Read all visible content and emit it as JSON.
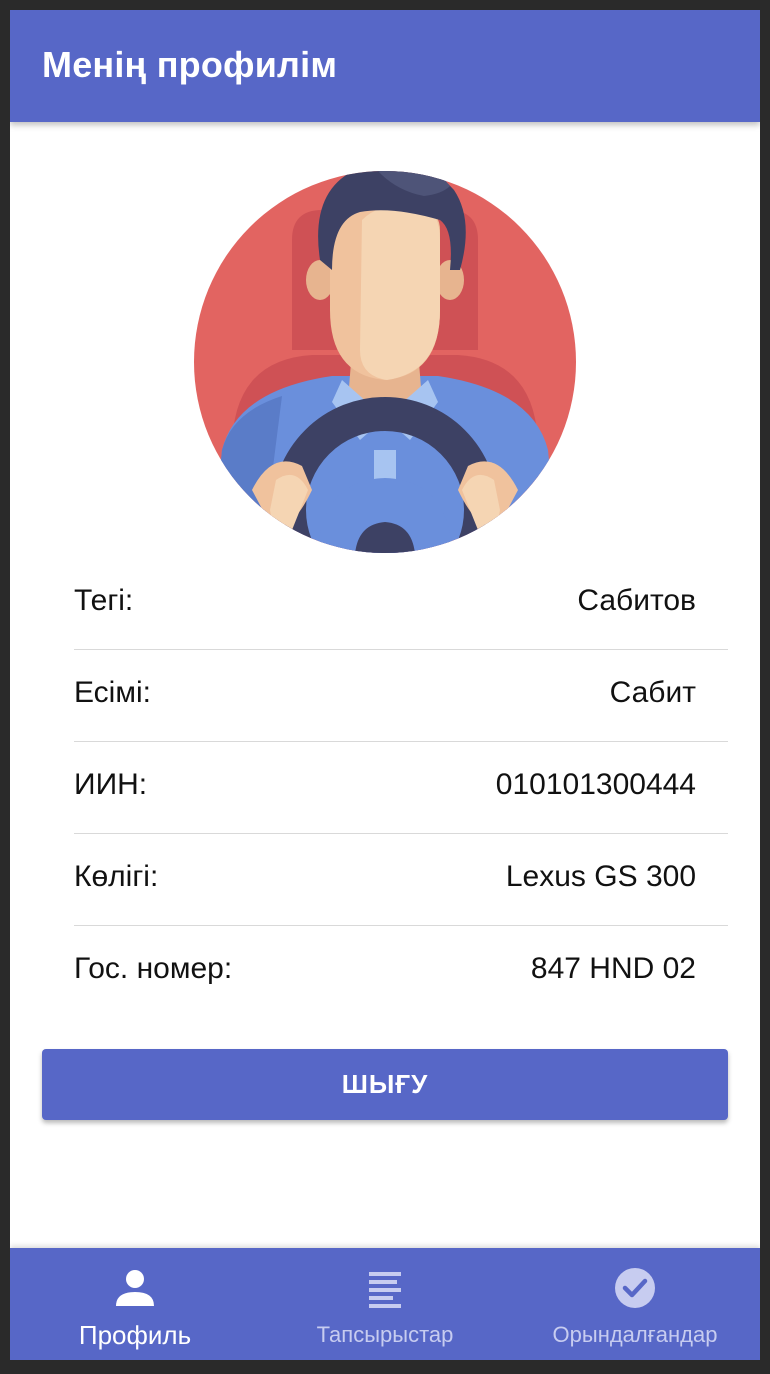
{
  "appbar": {
    "title": "Менің профилім"
  },
  "avatar": {
    "icon": "driver-avatar-icon"
  },
  "profile": {
    "rows": [
      {
        "label": "Тегі:",
        "value": "Сабитов"
      },
      {
        "label": "Есімі:",
        "value": "Сабит"
      },
      {
        "label": "ИИН:",
        "value": "010101300444"
      },
      {
        "label": "Көлігі:",
        "value": "Lexus GS 300"
      },
      {
        "label": "Гос. номер:",
        "value": "847 HND 02"
      }
    ]
  },
  "actions": {
    "logout_label": "ШЫҒУ"
  },
  "bottom_nav": {
    "items": [
      {
        "label": "Профиль",
        "icon": "person-icon",
        "active": true
      },
      {
        "label": "Тапсырыстар",
        "icon": "list-icon",
        "active": false
      },
      {
        "label": "Орындалғандар",
        "icon": "check-circle-icon",
        "active": false
      }
    ]
  },
  "colors": {
    "primary": "#5767c7",
    "avatar_bg": "#e26461"
  }
}
